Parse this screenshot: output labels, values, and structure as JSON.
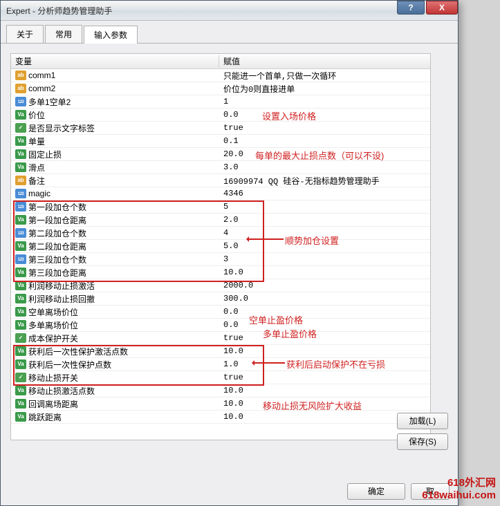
{
  "window": {
    "title": "Expert - 分析师趋势管理助手"
  },
  "titlebar": {
    "help": "?",
    "close": "X"
  },
  "tabs": {
    "about": "关于",
    "common": "常用",
    "inputs": "输入参数"
  },
  "grid": {
    "header_var": "变量",
    "header_val": "赋值",
    "rows": [
      {
        "icon": "ab",
        "name": "comm1",
        "val": "只能进一个首单,只做一次循环"
      },
      {
        "icon": "ab",
        "name": "comm2",
        "val": "价位为0则直接进单"
      },
      {
        "icon": "123",
        "name": "多单1空单2",
        "val": "1"
      },
      {
        "icon": "va",
        "name": "价位",
        "val": "0.0"
      },
      {
        "icon": "tf",
        "name": "是否显示文字标签",
        "val": "true"
      },
      {
        "icon": "va",
        "name": "单量",
        "val": "0.1"
      },
      {
        "icon": "va",
        "name": "固定止损",
        "val": "20.0"
      },
      {
        "icon": "va",
        "name": "滑点",
        "val": "3.0"
      },
      {
        "icon": "ab",
        "name": "备注",
        "val": "16909974 QQ 硅谷-无指标趋势管理助手"
      },
      {
        "icon": "123",
        "name": "magic",
        "val": "4346"
      },
      {
        "icon": "123",
        "name": "第一段加仓个数",
        "val": "5"
      },
      {
        "icon": "va",
        "name": "第一段加仓距离",
        "val": "2.0"
      },
      {
        "icon": "123",
        "name": "第二段加仓个数",
        "val": "4"
      },
      {
        "icon": "va",
        "name": "第二段加仓距离",
        "val": "5.0"
      },
      {
        "icon": "123",
        "name": "第三段加仓个数",
        "val": "3"
      },
      {
        "icon": "va",
        "name": "第三段加仓距离",
        "val": "10.0"
      },
      {
        "icon": "va",
        "name": "利润移动止损激活",
        "val": "2000.0"
      },
      {
        "icon": "va",
        "name": "利润移动止损回撤",
        "val": "300.0"
      },
      {
        "icon": "va",
        "name": "空单离场价位",
        "val": "0.0"
      },
      {
        "icon": "va",
        "name": "多单离场价位",
        "val": "0.0"
      },
      {
        "icon": "tf",
        "name": "成本保护开关",
        "val": "true"
      },
      {
        "icon": "va",
        "name": "获利后一次性保护激活点数",
        "val": "10.0"
      },
      {
        "icon": "va",
        "name": "获利后一次性保护点数",
        "val": "1.0"
      },
      {
        "icon": "tf",
        "name": "移动止损开关",
        "val": "true"
      },
      {
        "icon": "va",
        "name": "移动止损激活点数",
        "val": "10.0"
      },
      {
        "icon": "va",
        "name": "回调离场距离",
        "val": "10.0"
      },
      {
        "icon": "va",
        "name": "跳跃距离",
        "val": "10.0"
      }
    ]
  },
  "annotations": {
    "a1": "设置入场价格",
    "a2": "每单的最大止损点数（可以不设)",
    "a3": "顺势加仓设置",
    "a4": "空单止盈价格",
    "a5": "多单止盈价格",
    "a6": "获利后启动保护不在亏损",
    "a7": "移动止损无风险扩大收益"
  },
  "buttons": {
    "load": "加载(L)",
    "save": "保存(S)",
    "ok": "确定",
    "cancel": "取"
  },
  "watermark": {
    "l1": "618外汇网",
    "l2": "618waihui.com"
  }
}
